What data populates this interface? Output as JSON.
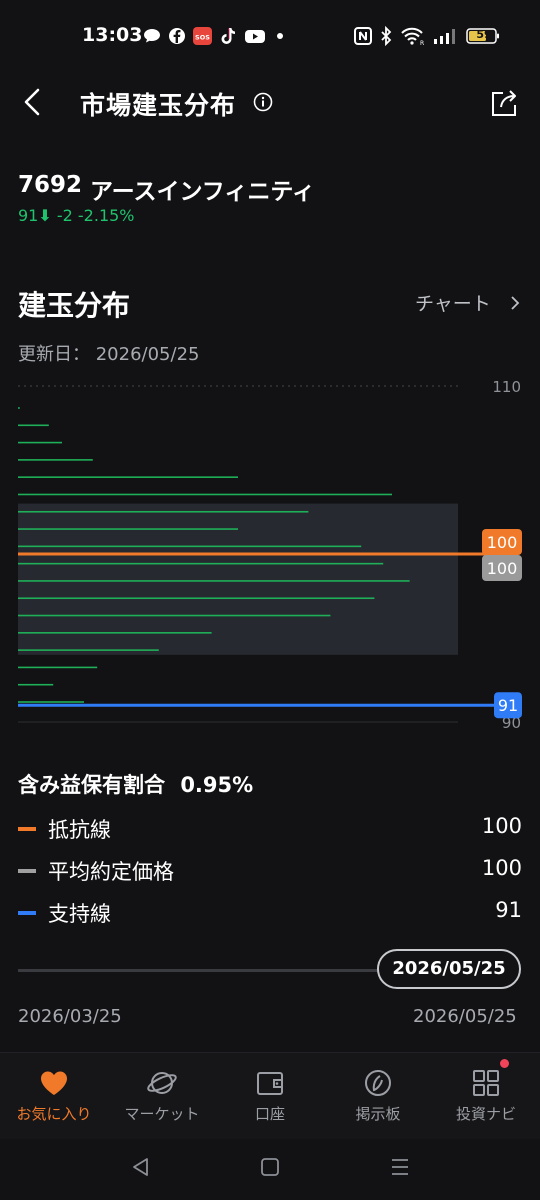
{
  "status_bar": {
    "time": "13:03",
    "battery": "59",
    "icons": [
      "chat-bubble-icon",
      "facebook-icon",
      "sos-icon",
      "tiktok-icon",
      "youtube-icon",
      "dot-icon",
      "nfc-icon",
      "bluetooth-icon",
      "wifi-icon",
      "signal-icon",
      "battery-icon"
    ]
  },
  "header": {
    "title": "市場建玉分布"
  },
  "stock": {
    "code": "7692",
    "name": "アースインフィニティ",
    "price": "91",
    "change": "-2",
    "change_pct": "-2.15%"
  },
  "section": {
    "title": "建玉分布",
    "chart_link": "チャート",
    "updated_label": "更新日：",
    "updated_date": "2026/05/25"
  },
  "chart_data": {
    "type": "bar",
    "orientation": "horizontal",
    "ylim": [
      90,
      110
    ],
    "y_ticks": [
      "110",
      "90"
    ],
    "bar_lengths": [
      0.004,
      0.07,
      0.1,
      0.17,
      0.5,
      0.85,
      0.66,
      0.5,
      0.78,
      0.83,
      0.89,
      0.81,
      0.71,
      0.44,
      0.32,
      0.18,
      0.08,
      0.15
    ],
    "highlight_range": [
      94,
      103
    ],
    "lines": [
      {
        "name": "抵抗線",
        "value": 100,
        "label": "100",
        "color": "#f07a2a"
      },
      {
        "name": "平均約定価格",
        "value": 100,
        "label": "100",
        "color": "#9a9a9a"
      },
      {
        "name": "支持線",
        "value": 91,
        "label": "91",
        "color": "#2f7cf6"
      }
    ]
  },
  "ratio": {
    "label": "含み益保有割合",
    "value": "0.95%"
  },
  "legend": [
    {
      "label": "抵抗線",
      "value": "100",
      "color": "#f07a2a"
    },
    {
      "label": "平均約定価格",
      "value": "100",
      "color": "#a0a0a0"
    },
    {
      "label": "支持線",
      "value": "91",
      "color": "#2f7cf6"
    }
  ],
  "timeline": {
    "selected": "2026/05/25",
    "start": "2026/03/25",
    "end": "2026/05/25"
  },
  "nav": [
    {
      "label": "お気に入り",
      "icon": "heart-icon",
      "active": true
    },
    {
      "label": "マーケット",
      "icon": "planet-icon",
      "active": false
    },
    {
      "label": "口座",
      "icon": "wallet-icon",
      "active": false
    },
    {
      "label": "掲示板",
      "icon": "board-icon",
      "active": false
    },
    {
      "label": "投資ナビ",
      "icon": "grid-icon",
      "active": false
    }
  ]
}
